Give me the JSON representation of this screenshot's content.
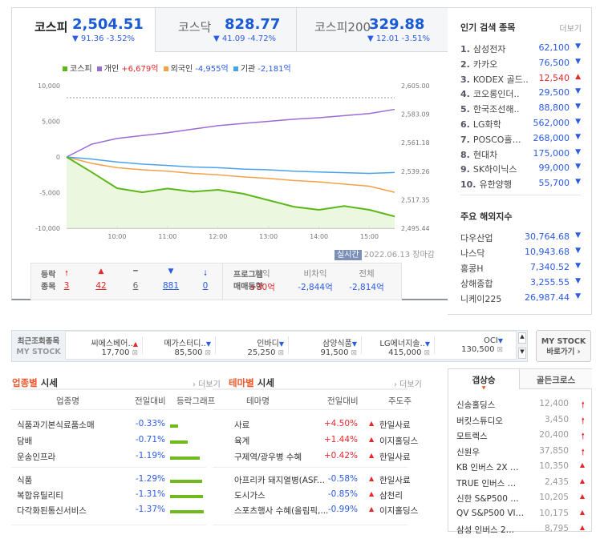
{
  "tabs": [
    {
      "name": "코스피",
      "value": "2,504.51",
      "change": "▼ 91.36  -3.52%"
    },
    {
      "name": "코스닥",
      "value": "828.77",
      "change": "▼ 41.09  -4.72%"
    },
    {
      "name": "코스피200",
      "value": "329.88",
      "change": "▼ 12.01  -3.51%"
    }
  ],
  "legend": {
    "kospi": "코스피",
    "individual": "개인",
    "individual_val": "+6,679억",
    "foreign": "외국인",
    "foreign_val": "-4,955억",
    "institution": "기관",
    "institution_val": "-2,181억"
  },
  "colors": {
    "kospi": "#5cb81a",
    "individual": "#9b6bd6",
    "foreign": "#f5a14a",
    "institution": "#4aa3ea"
  },
  "chart_data": {
    "type": "line",
    "x": [
      "09:00",
      "09:30",
      "10:00",
      "10:30",
      "11:00",
      "11:30",
      "12:00",
      "12:30",
      "13:00",
      "13:30",
      "14:00",
      "14:30",
      "15:00",
      "15:30"
    ],
    "left_ylim": [
      -10000,
      10000
    ],
    "left_ticks": [
      "10,000",
      "5,000",
      "0",
      "-5,000",
      "-10,000"
    ],
    "right_ylim": [
      2495.44,
      2605.0
    ],
    "right_ticks": [
      "2,605.00",
      "2,583.09",
      "2,561.18",
      "2,539.26",
      "2,517.35",
      "2,495.44"
    ],
    "x_ticks": [
      "10:00",
      "11:00",
      "12:00",
      "13:00",
      "14:00",
      "15:00"
    ],
    "series": [
      {
        "name": "개인",
        "axis": "left",
        "values": [
          0,
          1800,
          2600,
          3000,
          3400,
          3900,
          4400,
          4700,
          5000,
          5300,
          5500,
          5800,
          6100,
          6679
        ]
      },
      {
        "name": "외국인",
        "axis": "left",
        "values": [
          0,
          -900,
          -1500,
          -1800,
          -2000,
          -2300,
          -2500,
          -2800,
          -3000,
          -3300,
          -3500,
          -3800,
          -4100,
          -4955
        ]
      },
      {
        "name": "기관",
        "axis": "left",
        "values": [
          0,
          -300,
          -700,
          -1000,
          -1200,
          -1400,
          -1500,
          -1700,
          -1800,
          -2000,
          -2100,
          -2200,
          -2300,
          -2181
        ]
      },
      {
        "name": "코스피",
        "axis": "right",
        "values": [
          2550.2,
          2538.5,
          2526.2,
          2523.1,
          2526.0,
          2523.5,
          2525.0,
          2522.0,
          2517.0,
          2512.0,
          2509.6,
          2512.5,
          2509.6,
          2504.51
        ]
      }
    ]
  },
  "chart_footer": {
    "realtime": "실시간",
    "date": "2022.06.13",
    "status": "장마감"
  },
  "breadth": {
    "label1": "등락",
    "label2": "종목",
    "items": [
      {
        "icon": "up-limit",
        "sym": "🠕",
        "count": "3"
      },
      {
        "icon": "up",
        "sym": "▲",
        "count": "42"
      },
      {
        "icon": "flat",
        "sym": "━",
        "count": "6"
      },
      {
        "icon": "down",
        "sym": "▼",
        "count": "881"
      },
      {
        "icon": "down-limit",
        "sym": "🠗",
        "count": "0"
      }
    ]
  },
  "program": {
    "label1": "프로그램",
    "label2": "매매동향",
    "cols": [
      {
        "h": "차익",
        "v": "+30억"
      },
      {
        "h": "비차익",
        "v": "-2,844억"
      },
      {
        "h": "전체",
        "v": "-2,814억"
      }
    ]
  },
  "popular": {
    "title": "인기 검색 종목",
    "more": "더보기",
    "items": [
      {
        "rank": "1.",
        "name": "삼성전자",
        "price": "62,100",
        "dir": "down"
      },
      {
        "rank": "2.",
        "name": "카카오",
        "price": "76,500",
        "dir": "down"
      },
      {
        "rank": "3.",
        "name": "KODEX 골드..",
        "price": "12,540",
        "dir": "up"
      },
      {
        "rank": "4.",
        "name": "코오롱인더..",
        "price": "29,500",
        "dir": "down"
      },
      {
        "rank": "5.",
        "name": "한국조선해..",
        "price": "88,800",
        "dir": "down"
      },
      {
        "rank": "6.",
        "name": "LG화학",
        "price": "562,000",
        "dir": "down"
      },
      {
        "rank": "7.",
        "name": "POSCO홀…",
        "price": "268,000",
        "dir": "down"
      },
      {
        "rank": "8.",
        "name": "현대차",
        "price": "175,000",
        "dir": "down"
      },
      {
        "rank": "9.",
        "name": "SK하이닉스",
        "price": "99,000",
        "dir": "down"
      },
      {
        "rank": "10.",
        "name": "유한양행",
        "price": "55,700",
        "dir": "down"
      }
    ]
  },
  "overseas": {
    "title": "주요 해외지수",
    "items": [
      {
        "name": "다우산업",
        "value": "30,764.68"
      },
      {
        "name": "나스닥",
        "value": "10,943.68"
      },
      {
        "name": "홍콩H",
        "value": "7,340.52"
      },
      {
        "name": "상해종합",
        "value": "3,255.55"
      },
      {
        "name": "니케이225",
        "value": "26,987.44"
      }
    ]
  },
  "mystock": {
    "label1": "최근조회종목",
    "label2": "MY STOCK",
    "button1": "MY STOCK",
    "button2": "바로가기 ›",
    "items": [
      {
        "name": "씨에스베어..",
        "price": "17,700",
        "dir": "up"
      },
      {
        "name": "메가스터디..",
        "price": "85,500",
        "dir": "down"
      },
      {
        "name": "인바디",
        "price": "25,250",
        "dir": "down"
      },
      {
        "name": "삼양식품",
        "price": "91,500",
        "dir": "down"
      },
      {
        "name": "LG에너지솔..",
        "price": "415,000",
        "dir": "down"
      },
      {
        "name": "OCI",
        "price": "130,500",
        "dir": "down"
      }
    ]
  },
  "sector": {
    "title_a": "업종별",
    "title_b": " 시세",
    "more": "› 더보기",
    "headers": [
      "업종명",
      "전일대비",
      "등락그래프"
    ],
    "rows": [
      {
        "name": "식품과기본식료품소매",
        "chg": "-0.33%",
        "pct": 0.33
      },
      {
        "name": "담배",
        "chg": "-0.71%",
        "pct": 0.71
      },
      {
        "name": "운송인프라",
        "chg": "-1.19%",
        "pct": 1.19
      },
      {
        "name": "식품",
        "chg": "-1.29%",
        "pct": 1.29
      },
      {
        "name": "복합유틸리티",
        "chg": "-1.31%",
        "pct": 1.31
      },
      {
        "name": "다각화된통신서비스",
        "chg": "-1.37%",
        "pct": 1.37
      }
    ]
  },
  "theme": {
    "title_a": "테마별",
    "title_b": " 시세",
    "more": "› 더보기",
    "headers": [
      "테마명",
      "전일대비",
      "주도주"
    ],
    "rows": [
      {
        "name": "사료",
        "chg": "+4.50%",
        "lead": "한일사료"
      },
      {
        "name": "육계",
        "chg": "+1.44%",
        "lead": "이지홀딩스"
      },
      {
        "name": "구제역/광우병 수혜",
        "chg": "+0.42%",
        "lead": "한일사료"
      },
      {
        "name": "아프리카 돼지열병(ASF...",
        "chg": "-0.58%",
        "lead": "한일사료"
      },
      {
        "name": "도시가스",
        "chg": "-0.85%",
        "lead": "삼천리"
      },
      {
        "name": "스포츠행사 수혜(올림픽,...",
        "chg": "-0.99%",
        "lead": "이지홀딩스"
      }
    ]
  },
  "gap": {
    "tab1": "갭상승",
    "tab2": "골든크로스",
    "rows": [
      {
        "name": "신송홀딩스",
        "price": "12,400",
        "icon": "🠕"
      },
      {
        "name": "버킷스튜디오",
        "price": "3,450",
        "icon": "🠕"
      },
      {
        "name": "모트렉스",
        "price": "20,400",
        "icon": "🠕"
      },
      {
        "name": "신원우",
        "price": "37,850",
        "icon": "🠕"
      },
      {
        "name": "KB 인버스 2X …",
        "price": "10,350",
        "icon": "▲"
      },
      {
        "name": "TRUE 인버스 …",
        "price": "2,435",
        "icon": "▲"
      },
      {
        "name": "신한 S&P500 …",
        "price": "10,205",
        "icon": "▲"
      },
      {
        "name": "QV S&P500 VI…",
        "price": "10,175",
        "icon": "▲"
      },
      {
        "name": "삼성 인버스 2…",
        "price": "8,795",
        "icon": "▲"
      }
    ]
  }
}
